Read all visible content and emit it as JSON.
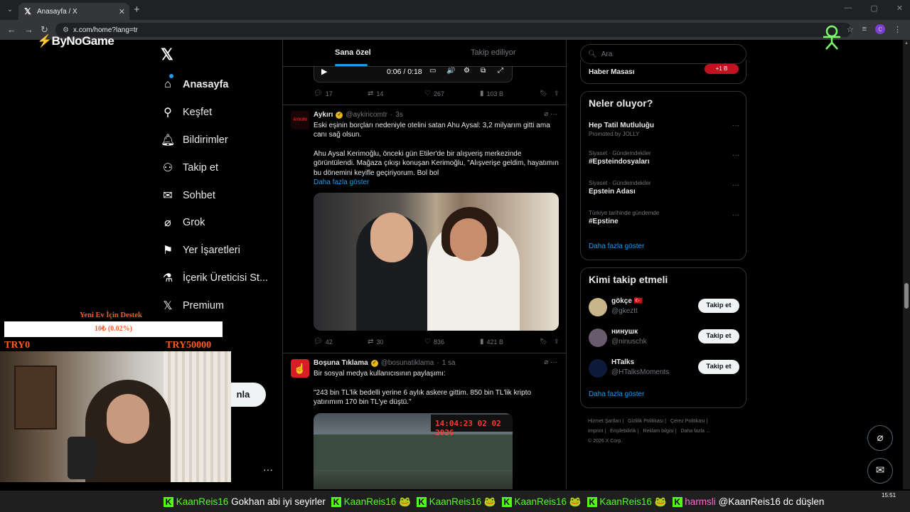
{
  "browser": {
    "tab_title": "Anasayfa / X",
    "url": "x.com/home?lang=tr",
    "profile_initial": "c"
  },
  "overlay": {
    "brand": "ByNoGame",
    "donation": {
      "title": "Yeni Ev İçin Destek",
      "progress_text": "10₺ (0.02%)",
      "progress_fraction": 0.0002,
      "min_label": "TRY0",
      "max_label": "TRY50000"
    }
  },
  "nav": {
    "items": [
      {
        "icon": "home-icon",
        "label": "Anasayfa"
      },
      {
        "icon": "search-icon",
        "label": "Keşfet"
      },
      {
        "icon": "bell-icon",
        "label": "Bildirimler"
      },
      {
        "icon": "follow-icon",
        "label": "Takip et"
      },
      {
        "icon": "mail-icon",
        "label": "Sohbet"
      },
      {
        "icon": "grok-icon",
        "label": "Grok"
      },
      {
        "icon": "bookmark-icon",
        "label": "Yer İşaretleri"
      },
      {
        "icon": "creator-icon",
        "label": "İçerik Üreticisi St..."
      },
      {
        "icon": "x-icon",
        "label": "Premium"
      }
    ],
    "post_button": "nla"
  },
  "feed": {
    "tabs": [
      "Sana özel",
      "Takip ediliyor"
    ],
    "video": {
      "time": "0:06 / 0:18"
    },
    "prev_actions": {
      "replies": "17",
      "reposts": "14",
      "likes": "267",
      "views": "103 B"
    },
    "tweets": [
      {
        "name": "Aykırı",
        "handle": "@aykiricomtr",
        "time": "3s",
        "avatar_text": "AYKIRI",
        "text_1": "Eski eşinin borçları nedeniyle otelini satan Ahu Aysal: 3,2 milyarım gitti ama canı sağ olsun.",
        "text_2": "Ahu Aysal Kerimoğlu, önceki gün Etiler'de bir alışveriş merkezinde görüntülendi. Mağaza çıkışı konuşan Kerimoğlu, \"Alışverişe geldim, hayatımın bu dönemini keyifle geçiriyorum. Bol bol",
        "show_more": "Daha fazla göster",
        "actions": {
          "replies": "42",
          "reposts": "30",
          "likes": "836",
          "views": "421 B"
        }
      },
      {
        "name": "Boşuna Tıklama",
        "handle": "@bosunatiklama",
        "time": "1 sa",
        "text_1": "Bir sosyal medya kullanıcısının paylaşımı:",
        "text_2": "\"243 bin TL'lik bedelli yerine 6 aylık askere gittim. 850 bin TL'lik kripto yatırımım 170 bin TL'ye düştü.\"",
        "image_board": "14:04:23 02 02 2026"
      }
    ]
  },
  "sidebar": {
    "search_placeholder": "Ara",
    "top_card": {
      "label": "Haber Masası",
      "badge": "+1 B"
    },
    "trends_title": "Neler oluyor?",
    "trends": [
      {
        "meta": "",
        "name": "Hep Tatil Mutluluğu",
        "promo": "Promoted by JOLLY"
      },
      {
        "meta": "Siyaset · Gündemdekiler",
        "name": "#Epsteindosyaları",
        "promo": ""
      },
      {
        "meta": "Siyaset · Gündemdekiler",
        "name": "Epstein Adası",
        "promo": ""
      },
      {
        "meta": "Türkiye tarihinde gündemde",
        "name": "#Epstine",
        "promo": ""
      }
    ],
    "trends_more": "Daha fazla göster",
    "who_title": "Kimi takip etmeli",
    "who": [
      {
        "name": "gökçe 🇹🇷",
        "handle": "@gkeztt",
        "button": "Takip et",
        "color": "#c9b58a"
      },
      {
        "name": "нинушк",
        "handle": "@ninuschk",
        "button": "Takip et",
        "color": "#6a5a6e"
      },
      {
        "name": "HTalks",
        "handle": "@HTalksMoments",
        "button": "Takip et",
        "color": "#0d1a3a"
      }
    ],
    "who_more": "Daha fazla göster",
    "footer": [
      "Hizmet Şartları |",
      "Gizlilik Politikası |",
      "Çerez Politikası |",
      "Imprint |",
      "Erişilebilirlik |",
      "Reklam bilgisi |",
      "Daha fazla ...",
      "© 2026 X Corp."
    ]
  },
  "ticker": [
    {
      "user": "KaanReis16",
      "msg": "Gokhan abi iyi seyirler"
    },
    {
      "user": "KaanReis16",
      "msg": "🐸"
    },
    {
      "user": "KaanReis16",
      "msg": "🐸"
    },
    {
      "user": "KaanReis16",
      "msg": "🐸"
    },
    {
      "user": "KaanReis16",
      "msg": "🐸"
    },
    {
      "user": "harmsli",
      "msg": "@KaanReis16 dc düşlen"
    }
  ],
  "clock": "15:51"
}
